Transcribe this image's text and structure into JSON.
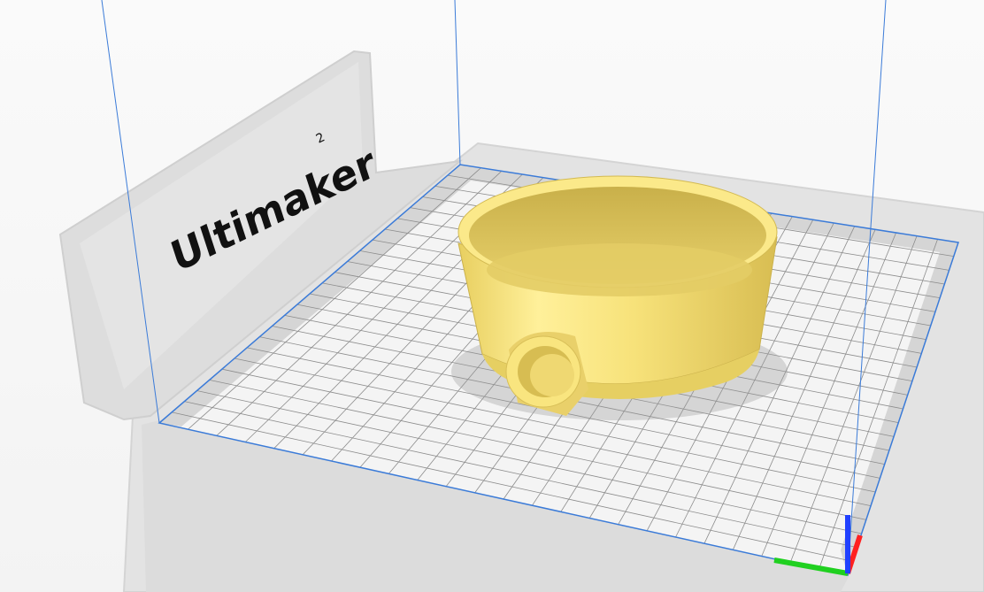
{
  "printer": {
    "brand_name": "Ultimaker",
    "model_number": "2"
  },
  "colors": {
    "model": "#f7e27a",
    "model_shade": "#e6cf62",
    "model_dark": "#c9b04a",
    "bed_grid": "#8c8c8c",
    "bed_border": "#3b7bd8",
    "axis_x": "#ff2020",
    "axis_y": "#20d020",
    "axis_z": "#2040ff"
  }
}
